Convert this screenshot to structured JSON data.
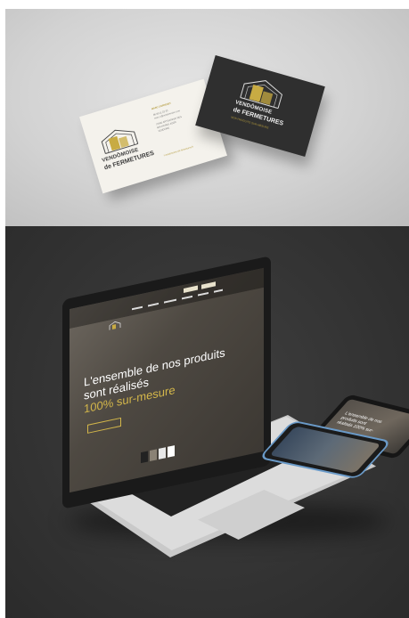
{
  "top_panel": {
    "card_white": {
      "brand_line1": "VENDÔMOISE",
      "brand_line2": "de FERMETURES",
      "contact_name": "MARC COPPENET",
      "contact_lines": [
        "06 00 11 22 33",
        "marc.c@vendomoise.com",
        "ZONE ARTISANALE DES",
        "BRUYERES 41100",
        "VENDÔME"
      ],
      "footer": "f  vendomoise-de-fermetures.fr"
    },
    "card_dark": {
      "brand_line1": "VENDÔMOISE",
      "brand_line2": "de FERMETURES",
      "tagline": "NOS PRODUITS SUR-MESURE"
    },
    "colors": {
      "gold": "#b39a3c",
      "card_white": "#f4f2ec",
      "card_dark": "#2f2f2f"
    }
  },
  "bottom_panel": {
    "laptop_screen": {
      "headline_line1": "L'ensemble de nos produits",
      "headline_line2": "sont réalisés",
      "highlight": "100% sur-mesure"
    },
    "tablet_screen": {
      "line1": "L'ensemble de nos",
      "line2": "produits sont",
      "line3": "réalisés 100% sur-"
    },
    "colors": {
      "background": "#343434",
      "accent": "#d3b64a",
      "phone_frame": "#6a9ac8"
    }
  }
}
